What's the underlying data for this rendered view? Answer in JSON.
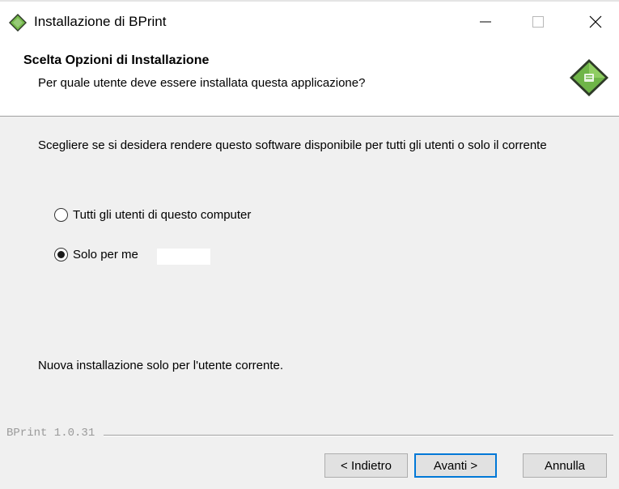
{
  "window": {
    "title": "Installazione di BPrint",
    "icons": {
      "app": "bprint-logo-icon",
      "minimize": "minimize-icon",
      "maximize": "maximize-icon",
      "close": "close-icon"
    }
  },
  "header": {
    "title": "Scelta Opzioni di Installazione",
    "subtitle": "Per quale utente deve essere installata questa applicazione?"
  },
  "body": {
    "description": "Scegliere se si desidera rendere questo software disponibile per tutti gli utenti o solo il corrente",
    "options": [
      {
        "label": "Tutti gli utenti di questo computer",
        "selected": false
      },
      {
        "label": "Solo per me",
        "selected": true
      }
    ],
    "status": "Nuova installazione solo per l'utente corrente."
  },
  "footer": {
    "brand": "BPrint 1.0.31",
    "back_label": "< Indietro",
    "next_label": "Avanti >",
    "cancel_label": "Annulla"
  },
  "colors": {
    "accent": "#0078d7",
    "logo_green": "#6ab04c",
    "logo_dark": "#2e3b2a"
  }
}
